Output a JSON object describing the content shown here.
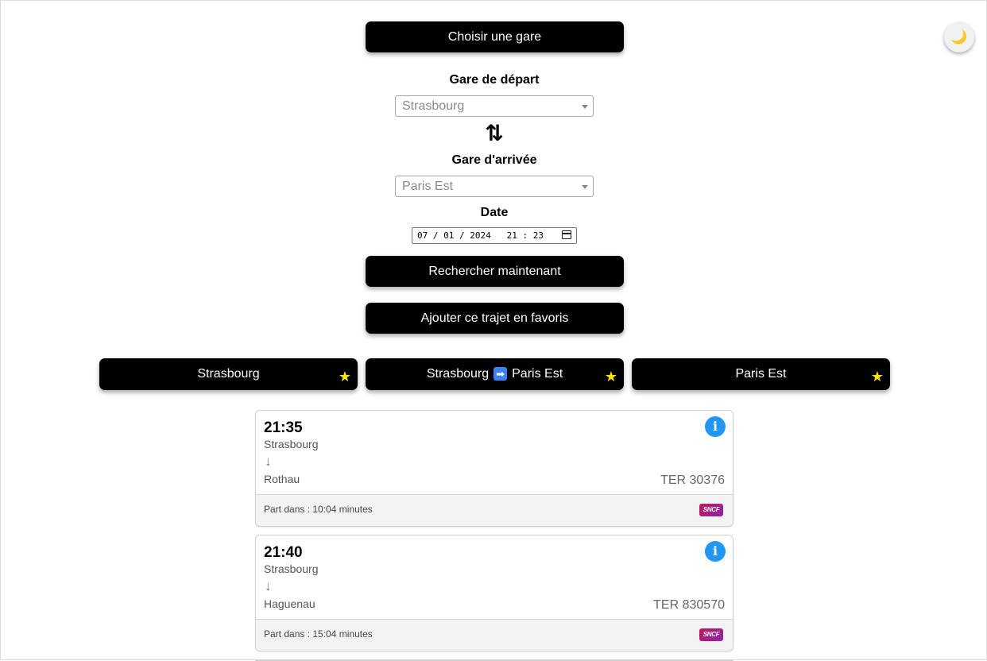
{
  "header": {
    "choose_station_label": "Choisir une gare"
  },
  "theme_toggle": {
    "icon": "moon-icon",
    "glyph": "🌙"
  },
  "form": {
    "departure_label": "Gare de départ",
    "departure_value": "Strasbourg",
    "swap_glyph": "⇅",
    "arrival_label": "Gare d'arrivée",
    "arrival_value": "Paris Est",
    "date_label": "Date",
    "date_value": "07 / 01 / 2024   21 : 23",
    "search_label": "Rechercher maintenant",
    "add_favorite_label": "Ajouter ce trajet en favoris"
  },
  "favorites": [
    {
      "label": "Strasbourg"
    },
    {
      "from": "Strasbourg",
      "to": "Paris Est",
      "arrow": "➡"
    },
    {
      "label": "Paris Est"
    }
  ],
  "star_glyph": "★",
  "trips": [
    {
      "time": "21:35",
      "from": "Strasbourg",
      "to": "Rothau",
      "train": "TER 30376",
      "departs_in": "Part dans : 10:04 minutes",
      "operator": "SNCF"
    },
    {
      "time": "21:40",
      "from": "Strasbourg",
      "to": "Haguenau",
      "train": "TER 830570",
      "departs_in": "Part dans : 15:04 minutes",
      "operator": "SNCF"
    }
  ],
  "colors": {
    "button_bg": "#000000",
    "info_blue": "#2196f3",
    "star_yellow": "#ffe600",
    "accent_blue": "#3b82f6"
  }
}
